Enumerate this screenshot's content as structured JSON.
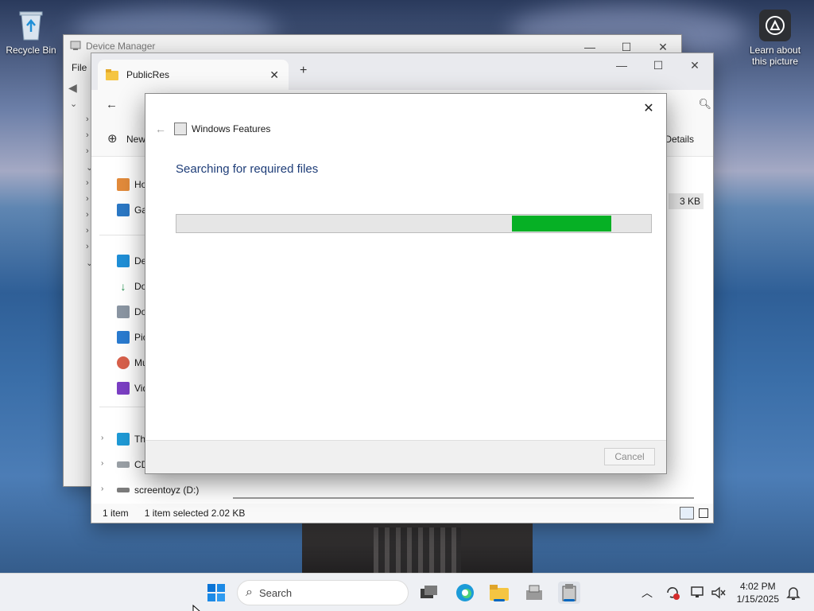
{
  "desktop": {
    "icons": [
      {
        "name": "recycle-bin",
        "label": "Recycle Bin"
      },
      {
        "name": "learn-about-this-picture",
        "label": "Learn about this picture"
      }
    ]
  },
  "device_manager": {
    "title": "Device Manager",
    "menu_file": "File"
  },
  "explorer": {
    "tab_title": "PublicRes",
    "new_button": "New",
    "details_button": "Details",
    "file_size": "3 KB",
    "nav_items": [
      "Ho",
      "Ga",
      "De",
      "Do",
      "Do",
      "Pic",
      "Mu",
      "Vid",
      "Th",
      "CD",
      "screentoyz (D:)"
    ],
    "status_count": "1 item",
    "status_selected": "1 item selected  2.02 KB"
  },
  "dialog": {
    "title": "Windows Features",
    "heading": "Searching for required files",
    "progress_segment_start": 0.71,
    "progress_segment_end": 0.92,
    "cancel_label": "Cancel",
    "progress_color": "#06b025"
  },
  "taskbar": {
    "search_placeholder": "Search",
    "time": "4:02 PM",
    "date": "1/15/2025",
    "accent": "#0067c0"
  }
}
